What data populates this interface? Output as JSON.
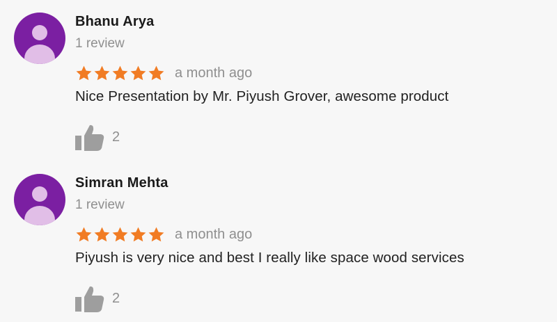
{
  "reviews": [
    {
      "name": "Bhanu Arya",
      "review_count": "1 review",
      "rating": 5,
      "date": "a month ago",
      "text": "Nice Presentation by Mr. Piyush Grover, awesome product",
      "likes": "2",
      "icons": {
        "avatar": "person-avatar-icon",
        "like": "thumbs-up-icon",
        "star": "star-icon"
      }
    },
    {
      "name": "Simran Mehta",
      "review_count": "1 review",
      "rating": 5,
      "date": "a month ago",
      "text": "Piyush is very nice and best I really like space wood services",
      "likes": "2",
      "icons": {
        "avatar": "person-avatar-icon",
        "like": "thumbs-up-icon",
        "star": "star-icon"
      }
    }
  ],
  "colors": {
    "avatar_bg": "#7b1fa2",
    "avatar_figure": "#e1bee7",
    "star": "#f17c24",
    "muted_text": "#8f8f8f",
    "like_icon": "#9e9e9e"
  }
}
